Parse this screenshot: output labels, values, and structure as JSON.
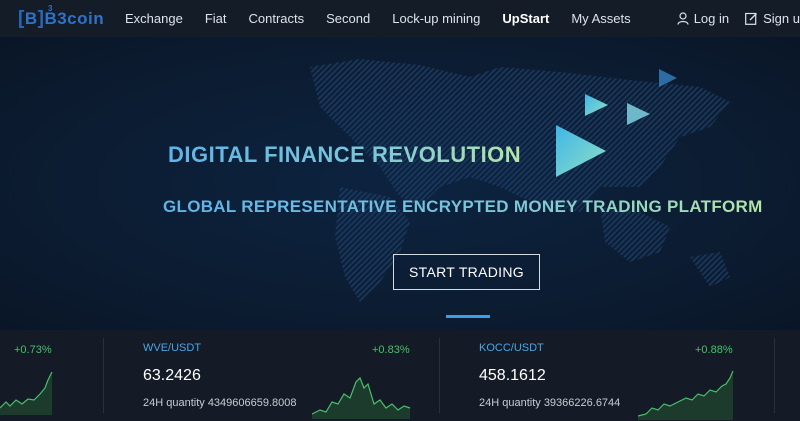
{
  "header": {
    "logo": {
      "bracket_open": "[",
      "letter": "B",
      "bracket_close": "]",
      "superscript": "3",
      "name": "B3coin"
    },
    "nav": [
      "Exchange",
      "Fiat",
      "Contracts",
      "Second",
      "Lock-up mining",
      "UpStart",
      "My Assets"
    ],
    "active_nav": "UpStart",
    "login_label": "Log in",
    "signup_label": "Sign u",
    "login_icon": "user-icon",
    "signup_icon": "edit-icon"
  },
  "hero": {
    "title": "DIGITAL FINANCE REVOLUTION",
    "subtitle": "GLOBAL REPRESENTATIVE ENCRYPTED MONEY TRADING PLATFORM",
    "cta": "START TRADING",
    "colors": {
      "gradient_start": "#5fb3ea",
      "gradient_end": "#b5e7a5",
      "accent": "#3b9ee6"
    }
  },
  "ticker": [
    {
      "pair": "",
      "change": "+0.73%",
      "price": "",
      "qty": ""
    },
    {
      "pair": "WVE/USDT",
      "change": "+0.83%",
      "price": "63.2426",
      "qty": "24H quantity 4349606659.8008"
    },
    {
      "pair": "KOCC/USDT",
      "change": "+0.88%",
      "price": "458.1612",
      "qty": "24H quantity 39366226.6744"
    }
  ],
  "colors": {
    "up": "#48c06a",
    "pair": "#4aa5e6",
    "background": "#0f1a2b"
  }
}
